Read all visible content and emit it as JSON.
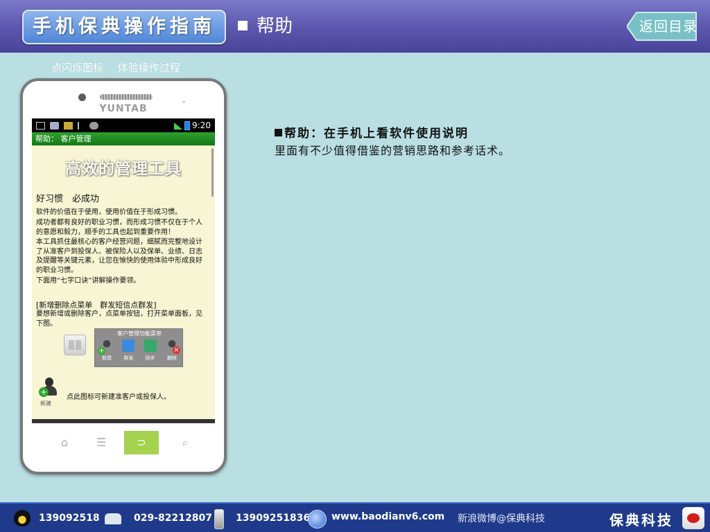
{
  "header": {
    "logo_text": "手机保典操作指南",
    "section_title": "帮助",
    "back_label": "返回目录"
  },
  "hint": {
    "part1": "点闪烁图标",
    "part2": "体验操作过程"
  },
  "phone": {
    "brand": "YUNTAB",
    "status_time": "9:20",
    "screen_title": "帮助： 客户管理",
    "big_title": "高效的管理工具",
    "subheading": "好习惯　必成功",
    "paragraphs": [
      "软件的价值在于使用，使用价值在于形成习惯。",
      "成功者都有良好的职业习惯，而形成习惯不仅在于个人的意愿和毅力，顺手的工具也起到重要作用！",
      "本工具抓住最核心的客户经营问题，细腻而完整地设计了从准客户到投保人、被保险人以及保单、业绩、日志及提醒等关键元素，让您在愉快的使用体验中形成良好的职业习惯。",
      "下面用“七字口诀”讲解操作要领。"
    ],
    "section_heading": "[新增删除点菜单　群发短信点群发]",
    "section_text": "要想新增或删除客户，点菜单按钮，打开菜单面板，见下图。",
    "menu_panel": {
      "title": "客户管理功能菜单",
      "items": [
        {
          "label": "新建",
          "icon": "add-user-icon"
        },
        {
          "label": "群发",
          "icon": "mail-icon"
        },
        {
          "label": "同步",
          "icon": "sync-icon"
        },
        {
          "label": "删除",
          "icon": "delete-user-icon"
        }
      ]
    },
    "new_icon_label": "新建",
    "new_icon_text": "点此图标可新建准客户或投保人。",
    "nav": {
      "home_icon": "⌂",
      "menu_icon": "☰",
      "back_icon": "⊃",
      "search_icon": "⌕"
    }
  },
  "content": {
    "title": "帮助：在手机上看软件使用说明",
    "description": "里面有不少值得借鉴的营销思路和参考话术。"
  },
  "footer": {
    "qq": "139092518",
    "phone": "029-82212807",
    "mobile": "13909251836",
    "website": "www.baodianv6.com",
    "weibo": "新浪微博@保典科技",
    "brand": "保典科技"
  },
  "colors": {
    "header_top": "#7b78c8",
    "header_bottom": "#4a4399",
    "background": "#b9dfe3",
    "footer": "#1f3a8a",
    "screen_title_green": "#2ea12e",
    "nav_back_green": "#a5d24f"
  }
}
